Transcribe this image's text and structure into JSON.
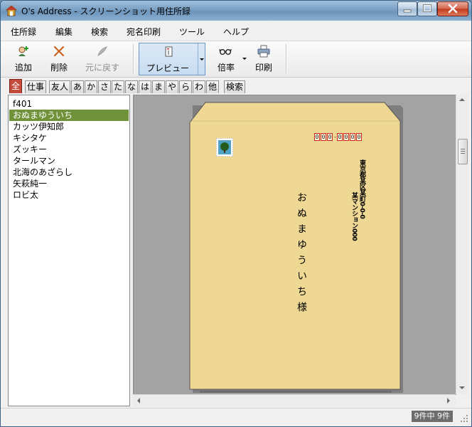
{
  "window": {
    "title": "O's Address - スクリーンショット用住所録"
  },
  "menu": [
    "住所録",
    "編集",
    "検索",
    "宛名印刷",
    "ツール",
    "ヘルプ"
  ],
  "toolbar": {
    "add": "追加",
    "delete": "削除",
    "undo": "元に戻す",
    "preview": "プレビュー",
    "zoom": "倍率",
    "print": "印刷"
  },
  "tabs": [
    "全",
    "仕事",
    "友人",
    "あ",
    "か",
    "さ",
    "た",
    "な",
    "は",
    "ま",
    "や",
    "ら",
    "わ",
    "他",
    "検索"
  ],
  "contacts": [
    "f401",
    "おぬまゆういち",
    "カッツ伊知郎",
    "キシタケ",
    "ズッキー",
    "タールマン",
    "北海のあざらし",
    "矢萩純一",
    "ロビ太"
  ],
  "selected_contact": "おぬまゆういち",
  "envelope": {
    "postal_code": "000-0000",
    "address_line1": "東京都某区某町0-0-0",
    "address_line2": "某マンション000",
    "recipient": "おぬまゆういち様",
    "envelope_color": "#efd894",
    "postal_box_color": "#cc2222"
  },
  "status": {
    "count": "9件中 9件"
  },
  "colors": {
    "selection": "#70923a",
    "active_tab": "#c44a3c"
  }
}
